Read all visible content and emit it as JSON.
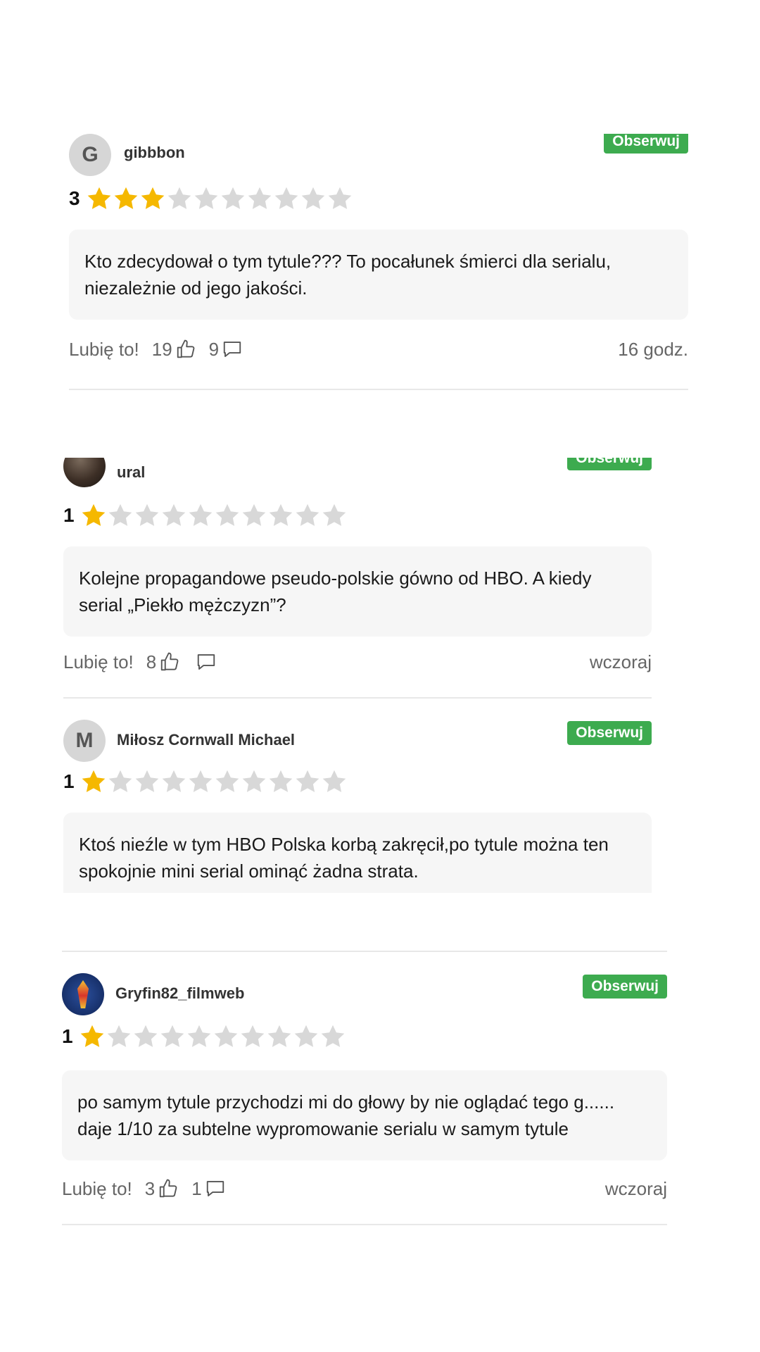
{
  "like_label": "Lubię to!",
  "follow_label": "Obserwuj",
  "star_colors": {
    "filled": "#f5b800",
    "empty": "#d8d8d8"
  },
  "reviews": [
    {
      "username": "gibbbon",
      "avatar_letter": "G",
      "rating": "3",
      "comment": "Kto zdecydował o tym tytule??? To pocałunek śmierci dla serialu, niezależnie od jego jakości.",
      "likes": "19",
      "replies": "9",
      "time": "16 godz."
    },
    {
      "username": "ural",
      "avatar_letter": "",
      "rating": "1",
      "comment": "Kolejne propagandowe pseudo-polskie gówno od HBO. A kiedy serial „Piekło mężczyzn”?",
      "likes": "8",
      "replies": "",
      "time": "wczoraj"
    },
    {
      "username": "Miłosz Cornwall Michael",
      "avatar_letter": "M",
      "rating": "1",
      "comment": "Ktoś nieźle w tym HBO Polska korbą zakręcił,po tytule można ten spokojnie mini serial ominąć żadna strata.",
      "likes": "",
      "replies": "",
      "time": ""
    },
    {
      "username": "Gryfin82_filmweb",
      "avatar_letter": "",
      "rating": "1",
      "comment": "po samym tytule przychodzi mi do głowy by nie oglądać tego g...... daje 1/10 za subtelne wypromowanie serialu w samym tytule",
      "likes": "3",
      "replies": "1",
      "time": "wczoraj"
    }
  ]
}
